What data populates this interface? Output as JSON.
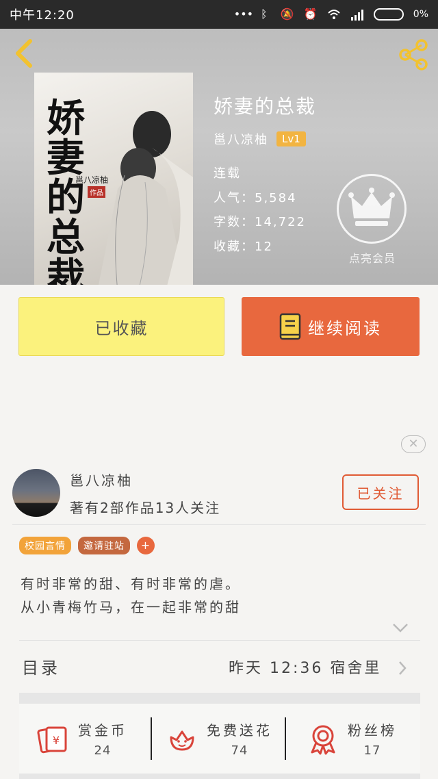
{
  "status_bar": {
    "time": "中午12:20",
    "battery": "0%"
  },
  "header": {
    "book_title": "娇妻的总裁",
    "author": "邕八凉柚",
    "level": "Lv1",
    "status": "连载",
    "popularity": "人气：5,584",
    "word_count": "字数：14,722",
    "favorites": "收藏：12",
    "vip_label": "点亮会员"
  },
  "cover": {
    "title": "娇妻的总裁",
    "author": "邕八凉柚",
    "seal": "作品"
  },
  "actions": {
    "collect_label": "已收藏",
    "read_label": "继续阅读"
  },
  "author_card": {
    "name": "邕八凉柚",
    "stats": "著有2部作品13人关注",
    "follow_label": "已关注"
  },
  "tags": [
    "校园言情",
    "邀请驻站",
    "+"
  ],
  "description": {
    "line1": "有时非常的甜、有时非常的虐。",
    "line2": "从小青梅竹马，在一起非常的甜"
  },
  "toc": {
    "label": "目录",
    "latest": "昨天 12:36 宿舍里"
  },
  "stats": [
    {
      "label": "赏金币",
      "value": "24",
      "icon": "red-envelope-icon"
    },
    {
      "label": "免费送花",
      "value": "74",
      "icon": "flower-icon"
    },
    {
      "label": "粉丝榜",
      "value": "17",
      "icon": "medal-icon"
    }
  ],
  "colors": {
    "accent": "#e8683e",
    "collect_bg": "#fbf27d",
    "level_badge": "#f2b441",
    "icon_red": "#d9443a"
  }
}
